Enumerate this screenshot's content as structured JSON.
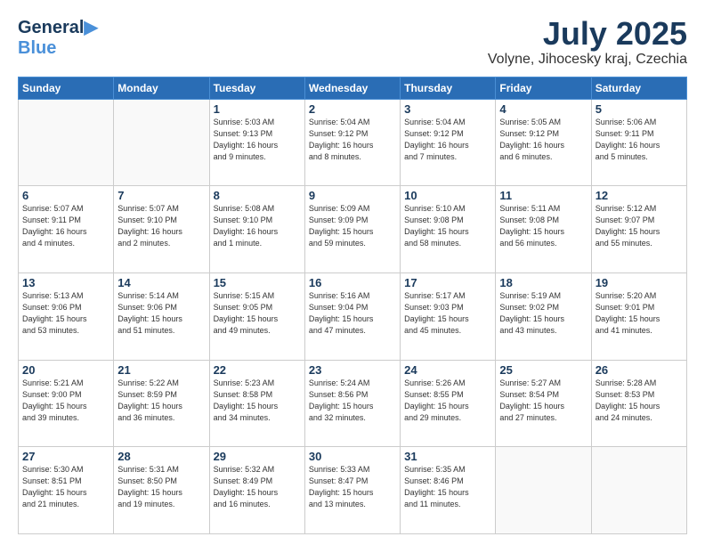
{
  "header": {
    "logo_line1": "General",
    "logo_line2": "Blue",
    "title": "July 2025",
    "subtitle": "Volyne, Jihocesky kraj, Czechia"
  },
  "weekdays": [
    "Sunday",
    "Monday",
    "Tuesday",
    "Wednesday",
    "Thursday",
    "Friday",
    "Saturday"
  ],
  "weeks": [
    [
      {
        "day": "",
        "info": ""
      },
      {
        "day": "",
        "info": ""
      },
      {
        "day": "1",
        "info": "Sunrise: 5:03 AM\nSunset: 9:13 PM\nDaylight: 16 hours\nand 9 minutes."
      },
      {
        "day": "2",
        "info": "Sunrise: 5:04 AM\nSunset: 9:12 PM\nDaylight: 16 hours\nand 8 minutes."
      },
      {
        "day": "3",
        "info": "Sunrise: 5:04 AM\nSunset: 9:12 PM\nDaylight: 16 hours\nand 7 minutes."
      },
      {
        "day": "4",
        "info": "Sunrise: 5:05 AM\nSunset: 9:12 PM\nDaylight: 16 hours\nand 6 minutes."
      },
      {
        "day": "5",
        "info": "Sunrise: 5:06 AM\nSunset: 9:11 PM\nDaylight: 16 hours\nand 5 minutes."
      }
    ],
    [
      {
        "day": "6",
        "info": "Sunrise: 5:07 AM\nSunset: 9:11 PM\nDaylight: 16 hours\nand 4 minutes."
      },
      {
        "day": "7",
        "info": "Sunrise: 5:07 AM\nSunset: 9:10 PM\nDaylight: 16 hours\nand 2 minutes."
      },
      {
        "day": "8",
        "info": "Sunrise: 5:08 AM\nSunset: 9:10 PM\nDaylight: 16 hours\nand 1 minute."
      },
      {
        "day": "9",
        "info": "Sunrise: 5:09 AM\nSunset: 9:09 PM\nDaylight: 15 hours\nand 59 minutes."
      },
      {
        "day": "10",
        "info": "Sunrise: 5:10 AM\nSunset: 9:08 PM\nDaylight: 15 hours\nand 58 minutes."
      },
      {
        "day": "11",
        "info": "Sunrise: 5:11 AM\nSunset: 9:08 PM\nDaylight: 15 hours\nand 56 minutes."
      },
      {
        "day": "12",
        "info": "Sunrise: 5:12 AM\nSunset: 9:07 PM\nDaylight: 15 hours\nand 55 minutes."
      }
    ],
    [
      {
        "day": "13",
        "info": "Sunrise: 5:13 AM\nSunset: 9:06 PM\nDaylight: 15 hours\nand 53 minutes."
      },
      {
        "day": "14",
        "info": "Sunrise: 5:14 AM\nSunset: 9:06 PM\nDaylight: 15 hours\nand 51 minutes."
      },
      {
        "day": "15",
        "info": "Sunrise: 5:15 AM\nSunset: 9:05 PM\nDaylight: 15 hours\nand 49 minutes."
      },
      {
        "day": "16",
        "info": "Sunrise: 5:16 AM\nSunset: 9:04 PM\nDaylight: 15 hours\nand 47 minutes."
      },
      {
        "day": "17",
        "info": "Sunrise: 5:17 AM\nSunset: 9:03 PM\nDaylight: 15 hours\nand 45 minutes."
      },
      {
        "day": "18",
        "info": "Sunrise: 5:19 AM\nSunset: 9:02 PM\nDaylight: 15 hours\nand 43 minutes."
      },
      {
        "day": "19",
        "info": "Sunrise: 5:20 AM\nSunset: 9:01 PM\nDaylight: 15 hours\nand 41 minutes."
      }
    ],
    [
      {
        "day": "20",
        "info": "Sunrise: 5:21 AM\nSunset: 9:00 PM\nDaylight: 15 hours\nand 39 minutes."
      },
      {
        "day": "21",
        "info": "Sunrise: 5:22 AM\nSunset: 8:59 PM\nDaylight: 15 hours\nand 36 minutes."
      },
      {
        "day": "22",
        "info": "Sunrise: 5:23 AM\nSunset: 8:58 PM\nDaylight: 15 hours\nand 34 minutes."
      },
      {
        "day": "23",
        "info": "Sunrise: 5:24 AM\nSunset: 8:56 PM\nDaylight: 15 hours\nand 32 minutes."
      },
      {
        "day": "24",
        "info": "Sunrise: 5:26 AM\nSunset: 8:55 PM\nDaylight: 15 hours\nand 29 minutes."
      },
      {
        "day": "25",
        "info": "Sunrise: 5:27 AM\nSunset: 8:54 PM\nDaylight: 15 hours\nand 27 minutes."
      },
      {
        "day": "26",
        "info": "Sunrise: 5:28 AM\nSunset: 8:53 PM\nDaylight: 15 hours\nand 24 minutes."
      }
    ],
    [
      {
        "day": "27",
        "info": "Sunrise: 5:30 AM\nSunset: 8:51 PM\nDaylight: 15 hours\nand 21 minutes."
      },
      {
        "day": "28",
        "info": "Sunrise: 5:31 AM\nSunset: 8:50 PM\nDaylight: 15 hours\nand 19 minutes."
      },
      {
        "day": "29",
        "info": "Sunrise: 5:32 AM\nSunset: 8:49 PM\nDaylight: 15 hours\nand 16 minutes."
      },
      {
        "day": "30",
        "info": "Sunrise: 5:33 AM\nSunset: 8:47 PM\nDaylight: 15 hours\nand 13 minutes."
      },
      {
        "day": "31",
        "info": "Sunrise: 5:35 AM\nSunset: 8:46 PM\nDaylight: 15 hours\nand 11 minutes."
      },
      {
        "day": "",
        "info": ""
      },
      {
        "day": "",
        "info": ""
      }
    ]
  ]
}
